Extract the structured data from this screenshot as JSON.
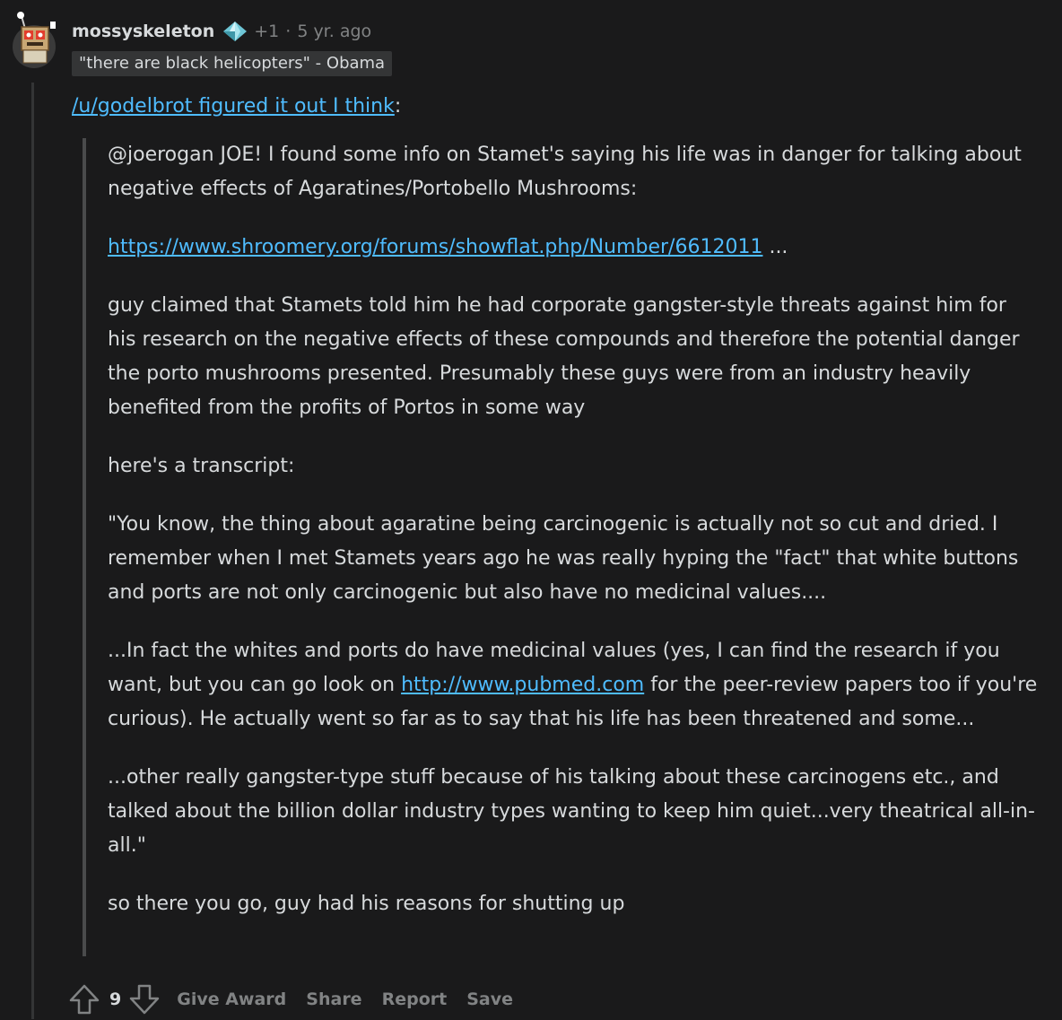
{
  "comment": {
    "username": "mossyskeleton",
    "karma": "+1",
    "separator": "·",
    "age": "5 yr. ago",
    "flair": "\"there are black helicopters\" - Obama",
    "lead_link_text": "/u/godelbrot figured it out I think",
    "lead_colon": ":",
    "quote": {
      "p1": "@joerogan JOE! I found some info on Stamet's saying his life was in danger for talking about negative effects of Agaratines/Portobello Mushrooms:",
      "link1": "https://www.shroomery.org/forums/showflat.php/Number/6612011",
      "link1_suffix": " ...",
      "p3": "guy claimed that Stamets told him he had corporate gangster-style threats against him for his research on the negative effects of these compounds and therefore the potential danger the porto mushrooms presented. Presumably these guys were from an industry heavily benefited from the profits of Portos in some way",
      "p4": "here's a transcript:",
      "p5": "\"You know, the thing about agaratine being carcinogenic is actually not so cut and dried. I remember when I met Stamets years ago he was really hyping the \"fact\" that white buttons and ports are not only carcinogenic but also have no medicinal values....",
      "p6_before": "...In fact the whites and ports do have medicinal values (yes, I can find the research if you want, but you can go look on ",
      "p6_link": "http://www.pubmed.com",
      "p6_after": " for the peer-review papers too if you're curious). He actually went so far as to say that his life has been threatened and some...",
      "p7": "...other really gangster-type stuff because of his talking about these carcinogens etc., and talked about the billion dollar industry types wanting to keep him quiet...very theatrical all-in-all.\"",
      "p8": "so there you go, guy had his reasons for shutting up"
    }
  },
  "actions": {
    "upvote_icon": "arrow-up-outline-icon",
    "score": "9",
    "downvote_icon": "arrow-down-outline-icon",
    "give_award": "Give Award",
    "share": "Share",
    "report": "Report",
    "save": "Save"
  },
  "colors": {
    "background": "#1a1a1b",
    "text": "#d7dadc",
    "muted": "#818384",
    "link": "#4fbcff",
    "flair_bg": "#343536"
  }
}
